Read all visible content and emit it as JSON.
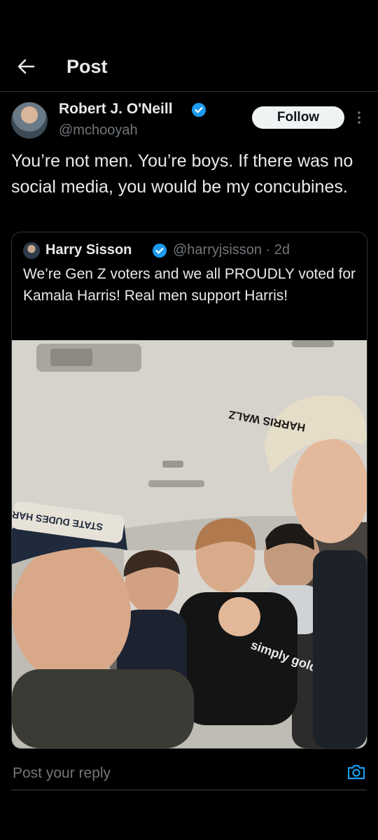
{
  "header": {
    "title": "Post",
    "back_icon": "arrow-left-icon"
  },
  "post": {
    "author_name": "Robert J. O'Neill",
    "author_handle": "@mchooyah",
    "follow_label": "Follow",
    "text": "You’re not men. You’re boys. If there was no social media, you would be my concubines."
  },
  "quoted": {
    "author_name": "Harry Sisson",
    "meta": "@harryjsisson · 2d",
    "text": "We’re Gen Z voters and we all PROUDLY voted for Kamala Harris! Real men support Harris!"
  },
  "photo": {
    "hat_text_right": "HARRIS WALZ",
    "hat_text_left": "STATE DUDES HARRIS",
    "shirt_text": "simply golden"
  },
  "reply": {
    "placeholder": "Post your reply",
    "camera_icon": "camera-icon"
  },
  "colors": {
    "background": "#000000",
    "text": "#e7e9ea",
    "muted": "#71767b",
    "accent": "#1d9bf0"
  }
}
